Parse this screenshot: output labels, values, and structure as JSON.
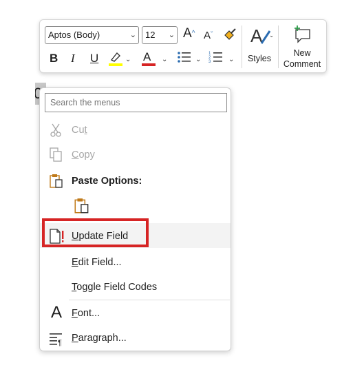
{
  "toolbar": {
    "font_name": "Aptos (Body)",
    "font_size": "12",
    "grow_font_glyph": "A",
    "shrink_font_glyph": "A",
    "bold_glyph": "B",
    "italic_glyph": "I",
    "underline_glyph": "U",
    "font_color_glyph": "A",
    "styles_label": "Styles",
    "new_comment_line1": "New",
    "new_comment_line2": "Comment",
    "highlight_color": "#ffff00",
    "font_color": "#d62424",
    "accent_color": "#2b6cb0"
  },
  "document": {
    "selected_char": "0"
  },
  "context_menu": {
    "search_placeholder": "Search the menus",
    "items": [
      {
        "prefix": "Cu",
        "accel": "t",
        "suffix": "",
        "enabled": false,
        "icon": "scissors-icon"
      },
      {
        "prefix": "",
        "accel": "C",
        "suffix": "opy",
        "enabled": false,
        "icon": "copy-icon"
      },
      {
        "prefix": "Paste Options:",
        "accel": "",
        "suffix": "",
        "enabled": true,
        "icon": "paste-icon"
      },
      {
        "prefix": "",
        "accel": "U",
        "suffix": "pdate Field",
        "enabled": true,
        "icon": "update-field-icon"
      },
      {
        "prefix": "",
        "accel": "E",
        "suffix": "dit Field...",
        "enabled": true,
        "icon": ""
      },
      {
        "prefix": "",
        "accel": "T",
        "suffix": "oggle Field Codes",
        "enabled": true,
        "icon": ""
      },
      {
        "prefix": "",
        "accel": "F",
        "suffix": "ont...",
        "enabled": true,
        "icon": "font-icon"
      },
      {
        "prefix": "",
        "accel": "P",
        "suffix": "aragraph...",
        "enabled": true,
        "icon": "paragraph-icon"
      }
    ],
    "font_icon_glyph": "A",
    "highlight_color": "#d62424"
  }
}
